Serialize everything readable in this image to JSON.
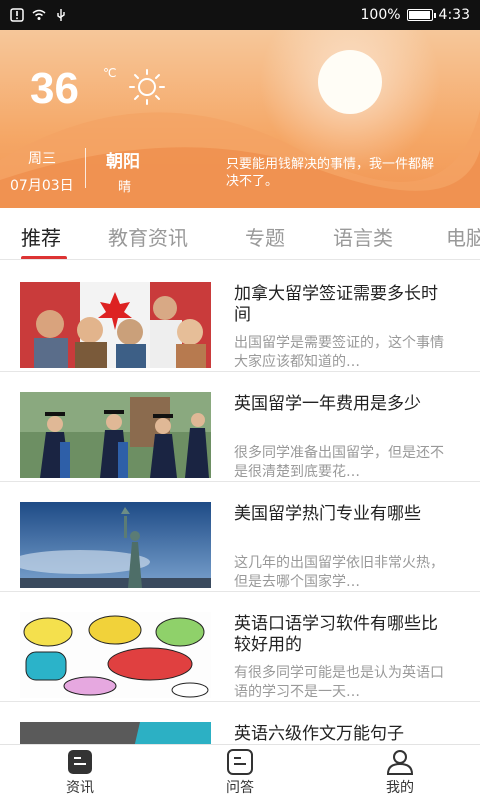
{
  "status_bar": {
    "battery": "100%",
    "battery_level": 1.0,
    "time": "4:33"
  },
  "weather": {
    "temperature": "36",
    "unit": "℃",
    "weekday": "周三",
    "date": "07月03日",
    "city": "朝阳",
    "condition": "晴",
    "motto": "只要能用钱解决的事情，我一件都解决不了。",
    "icon": "sun-icon"
  },
  "tabs": [
    {
      "label": "推荐",
      "active": true
    },
    {
      "label": "教育资讯",
      "active": false
    },
    {
      "label": "专题",
      "active": false
    },
    {
      "label": "语言类",
      "active": false
    },
    {
      "label": "电脑",
      "active": false
    }
  ],
  "articles": [
    {
      "title": "加拿大留学签证需要多长时间",
      "summary": "出国留学是需要签证的，这个事情大家应该都知道的…"
    },
    {
      "title": "英国留学一年费用是多少",
      "summary": "很多同学准备出国留学，但是还不是很清楚到底要花…"
    },
    {
      "title": "美国留学热门专业有哪些",
      "summary": "这几年的出国留学依旧非常火热，但是去哪个国家学…"
    },
    {
      "title": "英语口语学习软件有哪些比较好用的",
      "summary": "有很多同学可能是也是认为英语口语的学习不是一天…"
    },
    {
      "title": "英语六级作文万能句子",
      "summary": ""
    }
  ],
  "bottom_nav": [
    {
      "label": "资讯",
      "icon": "news-icon"
    },
    {
      "label": "问答",
      "icon": "qa-icon"
    },
    {
      "label": "我的",
      "icon": "profile-icon"
    }
  ]
}
